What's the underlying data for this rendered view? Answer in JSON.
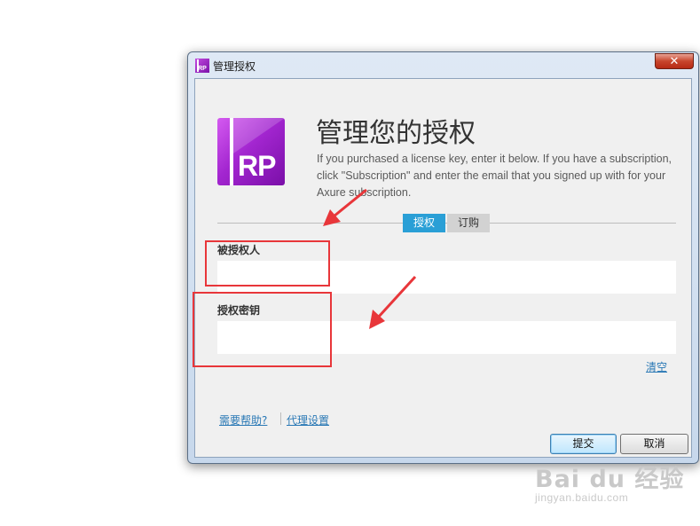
{
  "window": {
    "title": "管理授权",
    "close_glyph": "✕",
    "app_icon_text": "RP"
  },
  "header": {
    "logo_text": "RP",
    "title": "管理您的授权",
    "description": "If you purchased a license key, enter it below. If you have a subscription, click \"Subscription\" and enter the email that you signed up with for your Axure subscription."
  },
  "tabs": [
    {
      "label": "授权",
      "active": true
    },
    {
      "label": "订购",
      "active": false
    }
  ],
  "form": {
    "licensee_label": "被授权人",
    "licensee_value": "",
    "key_label": "授权密钥",
    "key_value": "",
    "clear_link": "清空"
  },
  "footer": {
    "help_link": "需要帮助?",
    "proxy_link": "代理设置",
    "submit_label": "提交",
    "cancel_label": "取消"
  },
  "watermark": {
    "main": "Bai du 经验",
    "sub": "jingyan.baidu.com"
  },
  "colors": {
    "accent": "#2a9fd6",
    "logo_purple": "#a326d0",
    "annotation_red": "#e8363a"
  }
}
